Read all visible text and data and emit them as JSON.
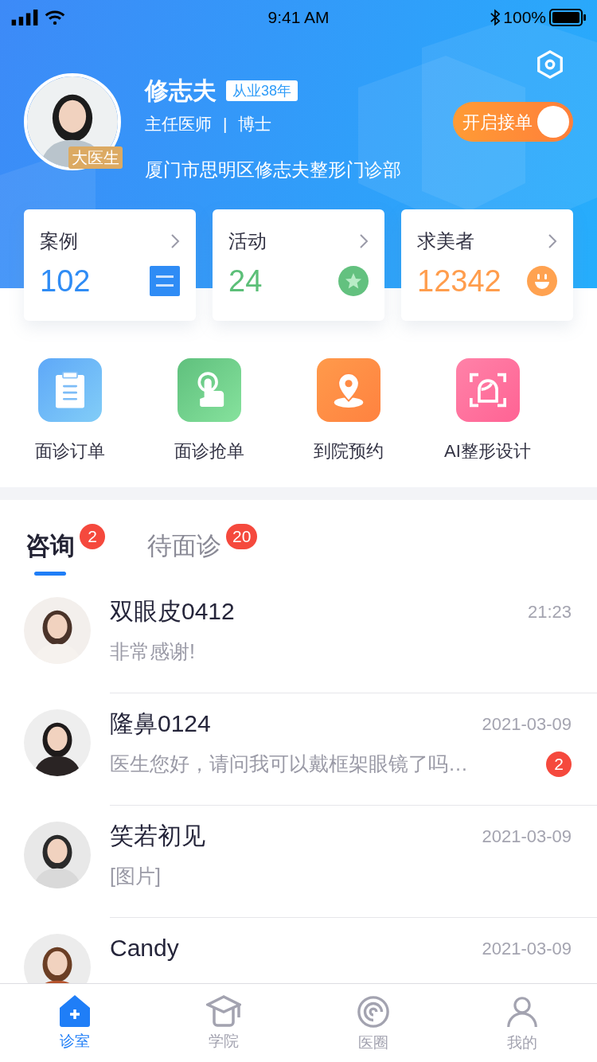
{
  "status_bar": {
    "time": "9:41 AM",
    "battery": "100%"
  },
  "profile": {
    "name": "修志夫",
    "experience": "从业38年",
    "title": "主任医师",
    "divider": "|",
    "degree": "博士",
    "badge": "大医生",
    "clinic": "厦门市思明区修志夫整形门诊部",
    "toggle": {
      "label": "开启接单",
      "on": true
    }
  },
  "stats": [
    {
      "label": "案例",
      "value": "102",
      "kind": "cases"
    },
    {
      "label": "活动",
      "value": "24",
      "kind": "activity"
    },
    {
      "label": "求美者",
      "value": "12342",
      "kind": "clients"
    }
  ],
  "actions": [
    {
      "label": "面诊订单",
      "kind": "clipboard"
    },
    {
      "label": "面诊抢单",
      "kind": "tap"
    },
    {
      "label": "到院预约",
      "kind": "location"
    },
    {
      "label": "AI整形设计",
      "kind": "face-scan"
    }
  ],
  "tabs": [
    {
      "label": "咨询",
      "badge": "2",
      "selected": true
    },
    {
      "label": "待面诊",
      "badge": "20",
      "selected": false
    }
  ],
  "conversations": [
    {
      "name": "双眼皮0412",
      "time": "21:23",
      "preview": "非常感谢!"
    },
    {
      "name": "隆鼻0124",
      "time": "2021-03-09",
      "preview": "医生您好，请问我可以戴框架眼镜了吗…",
      "unread": "2"
    },
    {
      "name": "笑若初见",
      "time": "2021-03-09",
      "preview": "[图片]"
    },
    {
      "name": "Candy",
      "time": "2021-03-09"
    }
  ],
  "nav": [
    {
      "label": "诊室",
      "kind": "home",
      "selected": true
    },
    {
      "label": "学院",
      "kind": "academy",
      "selected": false
    },
    {
      "label": "医圈",
      "kind": "circle",
      "selected": false
    },
    {
      "label": "我的",
      "kind": "me",
      "selected": false
    }
  ]
}
